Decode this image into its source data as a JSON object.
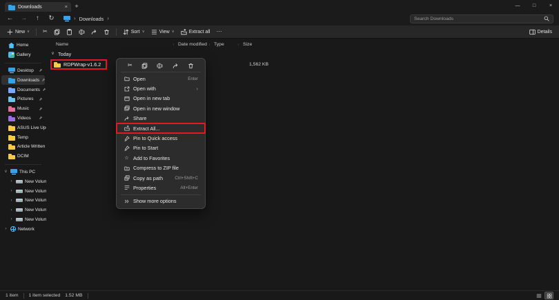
{
  "window": {
    "tab_title": "Downloads"
  },
  "nav": {
    "breadcrumb": "Downloads",
    "search_placeholder": "Search Downloads"
  },
  "toolbar": {
    "new": "New",
    "sort": "Sort",
    "view": "View",
    "extract_all": "Extract all",
    "details": "Details"
  },
  "list": {
    "columns": [
      "Name",
      "Date modified",
      "Type",
      "Size"
    ],
    "group": "Today",
    "files": [
      {
        "name": "RDPWrap-v1.6.2",
        "size": "1,562 KB"
      }
    ]
  },
  "sidebar": {
    "items": [
      {
        "label": "Home"
      },
      {
        "label": "Gallery"
      },
      {
        "label": "Desktop"
      },
      {
        "label": "Downloads"
      },
      {
        "label": "Documents"
      },
      {
        "label": "Pictures"
      },
      {
        "label": "Music"
      },
      {
        "label": "Videos"
      },
      {
        "label": "ASUS Live Update"
      },
      {
        "label": "Temp"
      },
      {
        "label": "Article Written"
      },
      {
        "label": "DCIM"
      },
      {
        "label": "This PC"
      },
      {
        "label": "New Volume (C:)"
      },
      {
        "label": "New Volume (D:)"
      },
      {
        "label": "New Volume (E:)"
      },
      {
        "label": "New Volume (F:)"
      },
      {
        "label": "New Volume (G:)"
      },
      {
        "label": "Network"
      }
    ]
  },
  "context_menu": {
    "items": [
      {
        "label": "Open",
        "shortcut": "Enter"
      },
      {
        "label": "Open with"
      },
      {
        "label": "Open in new tab"
      },
      {
        "label": "Open in new window"
      },
      {
        "label": "Share"
      },
      {
        "label": "Extract All..."
      },
      {
        "label": "Pin to Quick access"
      },
      {
        "label": "Pin to Start"
      },
      {
        "label": "Add to Favorites"
      },
      {
        "label": "Compress to ZIP file"
      },
      {
        "label": "Copy as path",
        "shortcut": "Ctrl+Shift+C"
      },
      {
        "label": "Properties",
        "shortcut": "Alt+Enter"
      },
      {
        "label": "Show more options"
      }
    ]
  },
  "status": {
    "count": "1 item",
    "selected": "1 item selected",
    "size": "1.52 MB"
  },
  "icons": {
    "back": "←",
    "forward": "→",
    "up": "↑",
    "refresh": "↻",
    "caret": "∨",
    "chevron_down": "∨",
    "chevron_right": "›",
    "crumb_sep": "›",
    "more": "⋯",
    "minimize": "—",
    "maximize": "□",
    "close": "×",
    "plus": "+",
    "star": "☆",
    "scissors": "✂",
    "tab_close": "×"
  },
  "colors": {
    "annotation_red": "#e01b24",
    "folder_yellow": "#f6c94a",
    "accent_blue": "#4cc2ff"
  }
}
